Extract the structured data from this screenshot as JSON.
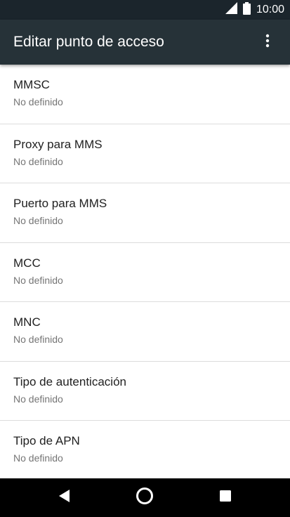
{
  "status_bar": {
    "time": "10:00",
    "icons": [
      "signal-icon",
      "battery-icon"
    ]
  },
  "app_bar": {
    "title": "Editar punto de acceso",
    "overflow_icon": "more-vert-icon"
  },
  "settings": {
    "items": [
      {
        "title": "MMSC",
        "value": "No definido"
      },
      {
        "title": "Proxy para MMS",
        "value": "No definido"
      },
      {
        "title": "Puerto para MMS",
        "value": "No definido"
      },
      {
        "title": "MCC",
        "value": "No definido"
      },
      {
        "title": "MNC",
        "value": "No definido"
      },
      {
        "title": "Tipo de autenticación",
        "value": "No definido"
      },
      {
        "title": "Tipo de APN",
        "value": "No definido"
      }
    ]
  },
  "nav_bar": {
    "icons": [
      "back-icon",
      "home-icon",
      "recents-icon"
    ]
  },
  "colors": {
    "status_bar": "#1b252c",
    "app_bar": "#263238",
    "title_text": "#212121",
    "subtitle_text": "#757575",
    "divider": "#dcdcdc",
    "nav_bar": "#000000"
  }
}
